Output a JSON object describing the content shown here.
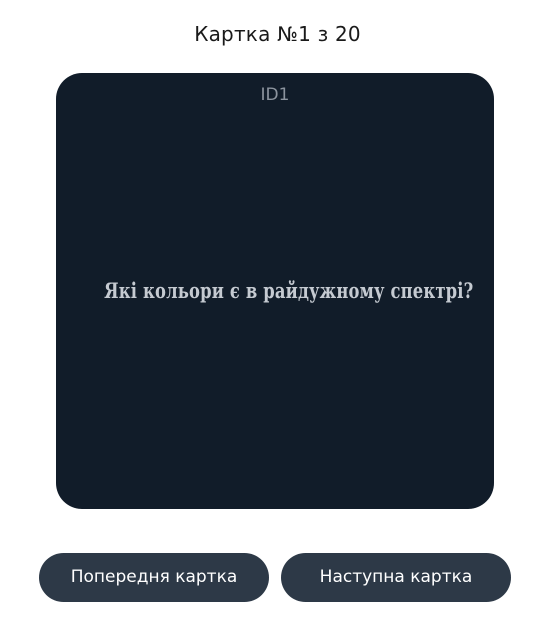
{
  "header": {
    "counter_text": "Картка №1 з 20"
  },
  "card": {
    "id_label": "ID1",
    "question": "Які кольори є в райдужному спектрі?"
  },
  "controls": {
    "prev_label": "Попередня картка",
    "next_label": "Наступна картка"
  },
  "colors": {
    "card_background": "#111c29",
    "button_background": "#2d3947",
    "question_text": "#c5cad1"
  }
}
